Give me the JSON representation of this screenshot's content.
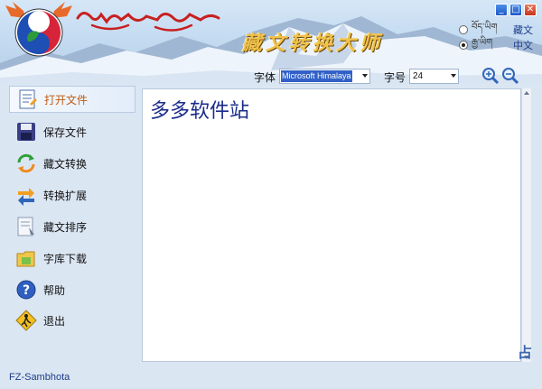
{
  "banner": {
    "tibetan_title": "ལྷ་ལྡན་བོད་ཡིག",
    "cn_title": "藏文转换大师"
  },
  "window": {
    "minimize_glyph": "_",
    "maximize_glyph": "□",
    "close_glyph": "✕"
  },
  "language": {
    "options": [
      {
        "native": "བོད་ཡིག",
        "label": "藏文",
        "selected": false
      },
      {
        "native": "རྒྱ་ཡིག",
        "label": "中文",
        "selected": true
      }
    ]
  },
  "font_bar": {
    "font_label": "字体",
    "font_value": "Microsoft Himalaya",
    "size_label": "字号",
    "size_value": "24"
  },
  "sidebar": {
    "items": [
      {
        "label": "打开文件",
        "icon": "open-file-icon",
        "active": true
      },
      {
        "label": "保存文件",
        "icon": "save-icon",
        "active": false
      },
      {
        "label": "藏文转换",
        "icon": "convert-icon",
        "active": false
      },
      {
        "label": "转换扩展",
        "icon": "extend-icon",
        "active": false
      },
      {
        "label": "藏文排序",
        "icon": "sort-icon",
        "active": false
      },
      {
        "label": "字库下载",
        "icon": "font-download-icon",
        "active": false
      },
      {
        "label": "帮助",
        "icon": "help-icon",
        "active": false
      },
      {
        "label": "退出",
        "icon": "exit-icon",
        "active": false
      }
    ]
  },
  "editor": {
    "text": "多多软件站"
  },
  "status": {
    "text": "FZ-Sambhota"
  },
  "watermark": {
    "text": "占"
  },
  "colors": {
    "accent": "#1a2b8a",
    "active_label": "#c15a11",
    "title_gold": "#f0c24a"
  }
}
